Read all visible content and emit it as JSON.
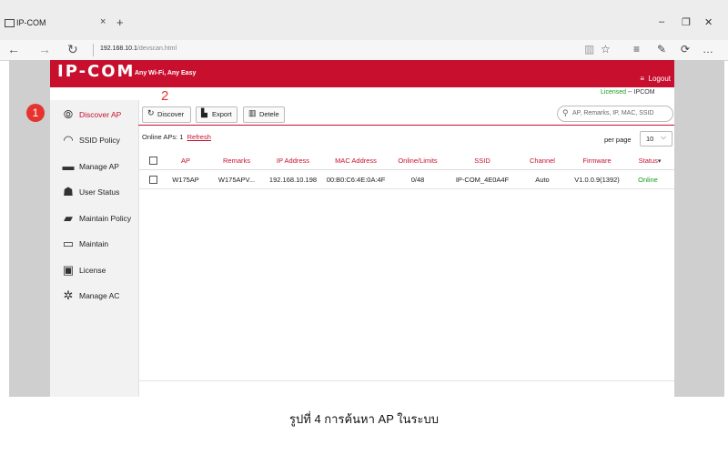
{
  "browser": {
    "tab_title": "IP-COM",
    "url_host": "192.168.10.1",
    "url_path": "/devscan.html",
    "glyphs": {
      "close": "×",
      "new_tab": "+",
      "back": "←",
      "forward": "→",
      "refresh": "↻",
      "minimize": "–",
      "restore": "❐",
      "close_window": "✕",
      "reading": "▥",
      "favorite": "☆",
      "hub": "≡",
      "note": "✎",
      "share": "⟳",
      "more": "…"
    }
  },
  "app": {
    "logo": "IP-COM",
    "tagline": "Any Wi-Fi, Any Easy",
    "logout_icon": "≡",
    "logout": "Logout",
    "licensed_status": "Licensed",
    "licensed_sep": " -- ",
    "licensed_brand": "IPCOM",
    "accent": "#c8102e"
  },
  "steps": {
    "one": "1",
    "two": "2"
  },
  "sidebar": {
    "items": [
      {
        "label": "Discover AP",
        "icon": "⦾"
      },
      {
        "label": "SSID Policy",
        "icon": "◠"
      },
      {
        "label": "Manage AP",
        "icon": "▬"
      },
      {
        "label": "User Status",
        "icon": "☗"
      },
      {
        "label": "Maintain Policy",
        "icon": "▰"
      },
      {
        "label": "Maintain",
        "icon": "▭"
      },
      {
        "label": "License",
        "icon": "▣"
      },
      {
        "label": "Manage AC",
        "icon": "✲"
      }
    ]
  },
  "toolbar": {
    "discover": "Discover",
    "discover_icon": "↻",
    "export": "Export",
    "export_icon": "▙",
    "delete": "Detele",
    "delete_icon": "▥",
    "search_icon": "⚲",
    "search_placeholder": "AP, Remarks, IP, MAC, SSID"
  },
  "list": {
    "online_label": "Online APs:",
    "online_count": "1",
    "refresh": "Refresh",
    "per_page_label": "per page",
    "per_page_value": "10",
    "per_page_chevron": "⌵"
  },
  "table": {
    "headers": [
      "AP",
      "Remarks",
      "IP Address",
      "MAC Address",
      "Online/Limits",
      "SSID",
      "Channel",
      "Firmware",
      "Status"
    ],
    "status_sort_icon": "▾",
    "rows": [
      {
        "ap": "W175AP",
        "remarks": "W175APV...",
        "ip": "192.168.10.198",
        "mac": "00:B0:C6:4E:0A:4F",
        "online": "0/48",
        "ssid": "IP-COM_4E0A4F",
        "channel": "Auto",
        "firmware": "V1.0.0.9(1392)",
        "status": "Online",
        "status_color": "#1a9e1a"
      }
    ]
  },
  "caption": "รูปที่ 4 การค้นหา AP ในระบบ"
}
